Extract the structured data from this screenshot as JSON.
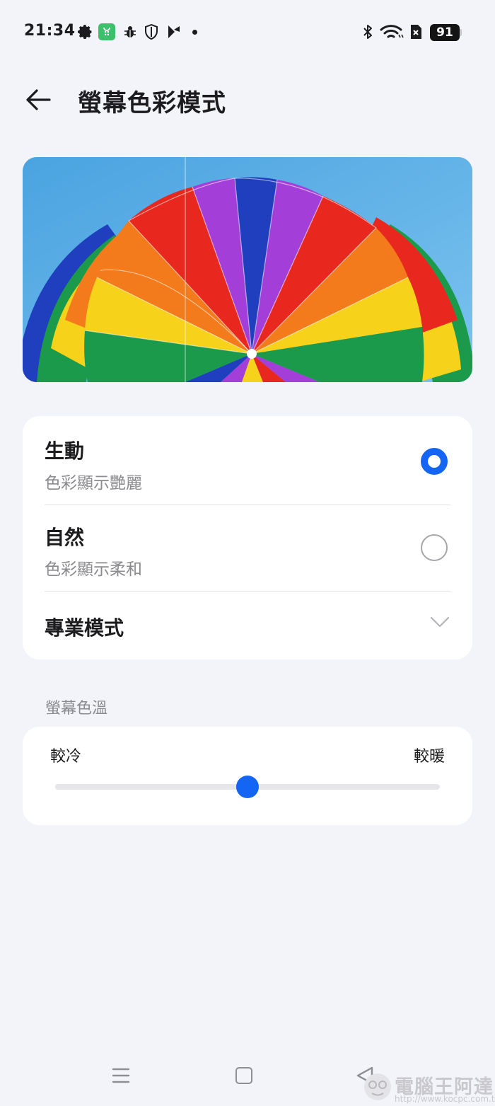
{
  "status_bar": {
    "time": "21:34",
    "battery": "91",
    "left_icons": [
      "gear-icon",
      "app-store-icon",
      "bug-icon",
      "shield-icon",
      "play-icon"
    ],
    "right_icons": [
      "bluetooth-icon",
      "wifi-icon",
      "sim-off-icon",
      "battery-icon"
    ]
  },
  "header": {
    "title": "螢幕色彩模式"
  },
  "modes": [
    {
      "title": "生動",
      "subtitle": "色彩顯示艷麗",
      "selected": true
    },
    {
      "title": "自然",
      "subtitle": "色彩顯示柔和",
      "selected": false
    }
  ],
  "pro_mode": {
    "label": "專業模式"
  },
  "color_temp": {
    "section_label": "螢幕色溫",
    "cool_label": "較冷",
    "warm_label": "較暖",
    "value_fraction": 0.5
  },
  "colors": {
    "accent": "#1565f5",
    "background": "#f3f4f9",
    "card": "#ffffff"
  },
  "watermark": {
    "text": "電腦王阿達",
    "url": "http://www.kocpc.com.tw"
  }
}
